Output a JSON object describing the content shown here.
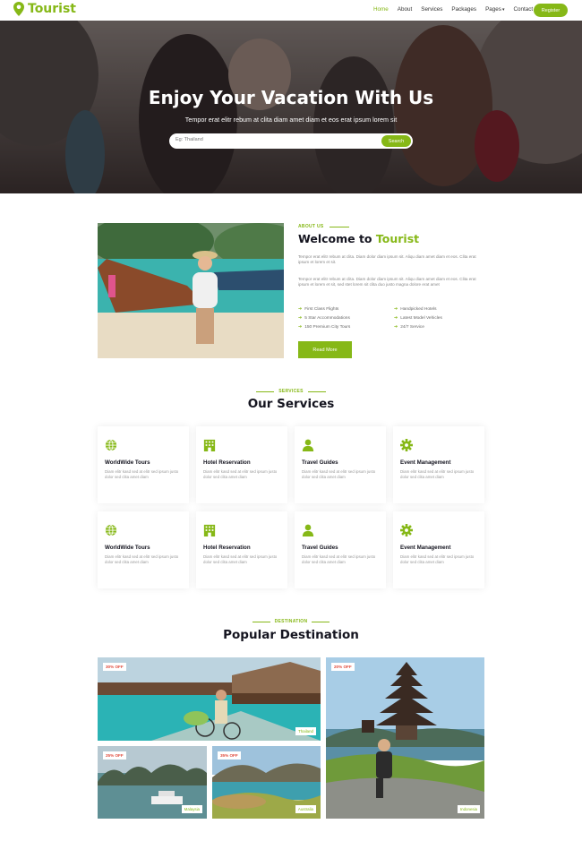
{
  "brand": {
    "name": "Tourist",
    "icon": "map-marker-icon"
  },
  "nav": {
    "items": [
      "Home",
      "About",
      "Services",
      "Packages",
      "Pages",
      "Contact"
    ],
    "active": "Home",
    "register_label": "Register"
  },
  "hero": {
    "title": "Enjoy Your Vacation With Us",
    "subtitle": "Tempor erat elitr rebum at clita diam amet diam et eos erat ipsum lorem sit",
    "search_placeholder": "Eg: Thailand",
    "search_button": "Search"
  },
  "about": {
    "label": "ABOUT US",
    "title_prefix": "Welcome to",
    "title_highlight": "Tourist",
    "para1": "Tempor erat elitr rebum at clita. Diam dolor diam ipsum sit. Aliqu diam amet diam et eos. Clita erat ipsum et lorem et sit.",
    "para2": "Tempor erat elitr rebum at clita. Diam dolor diam ipsum sit. Aliqu diam amet diam et eos. Clita erat ipsum et lorem et sit, sed stet lorem sit clita duo justo magna dolore erat amet",
    "features": [
      "First Class Flights",
      "Handpicked Hotels",
      "5 Star Accommodations",
      "Latest Model Vehicles",
      "150 Premium City Tours",
      "24/7 Service"
    ],
    "read_more": "Read More"
  },
  "services": {
    "label": "SERVICES",
    "title": "Our Services",
    "cards": [
      {
        "title": "WorldWide Tours",
        "icon": "globe-icon",
        "desc": "Diam elitr kasd sed at elitr sed ipsum justo dolor sed clita amet diam"
      },
      {
        "title": "Hotel Reservation",
        "icon": "hotel-icon",
        "desc": "Diam elitr kasd sed at elitr sed ipsum justo dolor sed clita amet diam"
      },
      {
        "title": "Travel Guides",
        "icon": "user-icon",
        "desc": "Diam elitr kasd sed at elitr sed ipsum justo dolor sed clita amet diam"
      },
      {
        "title": "Event Management",
        "icon": "cog-icon",
        "desc": "Diam elitr kasd sed at elitr sed ipsum justo dolor sed clita amet diam"
      },
      {
        "title": "WorldWide Tours",
        "icon": "globe-icon",
        "desc": "Diam elitr kasd sed at elitr sed ipsum justo dolor sed clita amet diam"
      },
      {
        "title": "Hotel Reservation",
        "icon": "hotel-icon",
        "desc": "Diam elitr kasd sed at elitr sed ipsum justo dolor sed clita amet diam"
      },
      {
        "title": "Travel Guides",
        "icon": "user-icon",
        "desc": "Diam elitr kasd sed at elitr sed ipsum justo dolor sed clita amet diam"
      },
      {
        "title": "Event Management",
        "icon": "cog-icon",
        "desc": "Diam elitr kasd sed at elitr sed ipsum justo dolor sed clita amet diam"
      }
    ]
  },
  "destination": {
    "label": "DESTINATION",
    "title": "Popular Destination",
    "items": [
      {
        "discount": "30% OFF",
        "name": "Thailand"
      },
      {
        "discount": "25% OFF",
        "name": "Malaysia"
      },
      {
        "discount": "35% OFF",
        "name": "Australia"
      },
      {
        "discount": "20% OFF",
        "name": "Indonesia"
      }
    ]
  },
  "colors": {
    "accent": "#86b817",
    "heading": "#14141f",
    "discount": "#e04a3b"
  }
}
